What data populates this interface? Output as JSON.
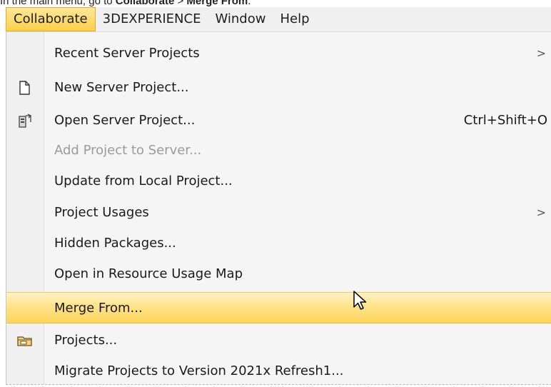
{
  "caption": {
    "prefix": "In the main menu, go to ",
    "menu": "Collaborate",
    "sep": " > ",
    "command": "Merge From",
    "suffix": "."
  },
  "menubar": {
    "items": [
      {
        "label": "Collaborate",
        "active": true
      },
      {
        "label": "3DEXPERIENCE"
      },
      {
        "label": "Window"
      },
      {
        "label": "Help"
      }
    ]
  },
  "menu": {
    "items": [
      {
        "label": "Recent Server Projects",
        "submenu": true
      },
      {
        "label": "New Server Project...",
        "icon": "new-document-icon"
      },
      {
        "label": "Open Server Project...",
        "shortcut": "Ctrl+Shift+O",
        "icon": "open-server-project-icon"
      },
      {
        "label": "Add Project to Server...",
        "disabled": true
      },
      {
        "label": "Update from Local Project..."
      },
      {
        "label": "Project Usages",
        "submenu": true
      },
      {
        "label": "Hidden Packages..."
      },
      {
        "label": "Open in Resource Usage Map"
      },
      {
        "label": "Merge From...",
        "highlighted": true
      },
      {
        "label": "Projects...",
        "icon": "folder-icon"
      },
      {
        "label": "Migrate Projects to Version 2021x Refresh1..."
      }
    ],
    "submenu_arrow": ">"
  },
  "colors": {
    "highlight": "#fbd45a",
    "menu_bg": "#f5f5f5",
    "disabled_text": "#9a9a9a"
  }
}
